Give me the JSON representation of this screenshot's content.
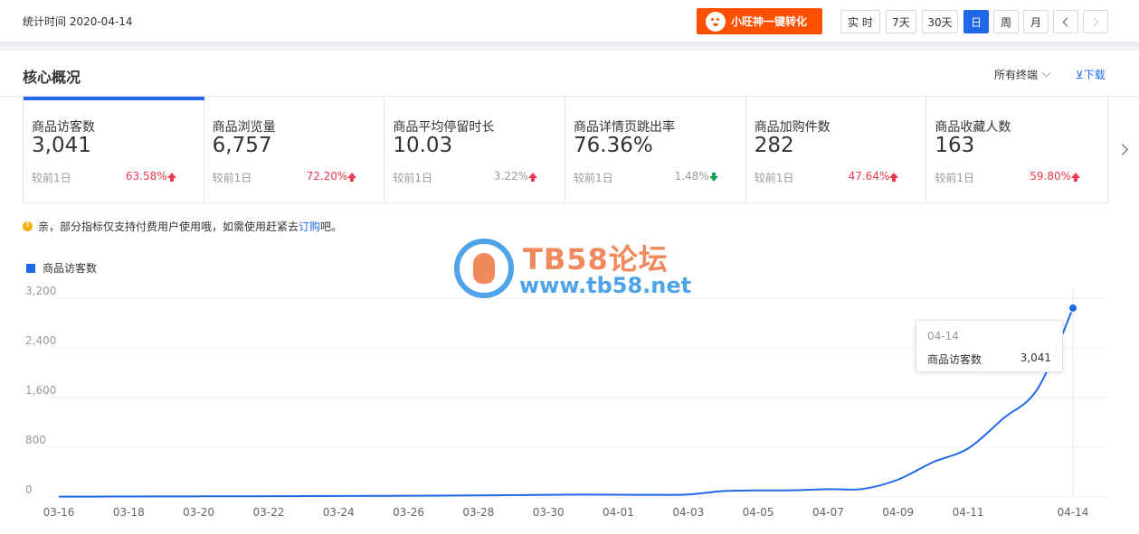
{
  "header": {
    "stat_time": "统计时间 2020-04-14",
    "promo_label": "小旺神一键转化",
    "periods": [
      {
        "label": "实 时",
        "active": false
      },
      {
        "label": "7天",
        "active": false
      },
      {
        "label": "30天",
        "active": false
      },
      {
        "label": "日",
        "active": true
      },
      {
        "label": "周",
        "active": false
      },
      {
        "label": "月",
        "active": false
      }
    ],
    "prev_icon": "chevron-left-icon",
    "next_icon": "chevron-right-icon"
  },
  "panel": {
    "title": "核心概况",
    "terminal_select": "所有终端",
    "download_label": "⊻下载"
  },
  "metrics": [
    {
      "label": "商品访客数",
      "value": "3,041",
      "compare_label": "较前1日",
      "change": "63.58%",
      "direction": "up"
    },
    {
      "label": "商品浏览量",
      "value": "6,757",
      "compare_label": "较前1日",
      "change": "72.20%",
      "direction": "up"
    },
    {
      "label": "商品平均停留时长",
      "value": "10.03",
      "compare_label": "较前1日",
      "change": "3.22%",
      "direction": "up"
    },
    {
      "label": "商品详情页跳出率",
      "value": "76.36%",
      "compare_label": "较前1日",
      "change": "1.48%",
      "direction": "down"
    },
    {
      "label": "商品加购件数",
      "value": "282",
      "compare_label": "较前1日",
      "change": "47.64%",
      "direction": "up"
    },
    {
      "label": "商品收藏人数",
      "value": "163",
      "compare_label": "较前1日",
      "change": "59.80%",
      "direction": "up"
    }
  ],
  "notice": {
    "text": "亲，部分指标仅支持付费用户使用哦，如需使用赶紧去 ",
    "link": "订购",
    "suffix": "吧。"
  },
  "watermark": {
    "title": "TB58论坛",
    "url": "www.tb58.net"
  },
  "tooltip": {
    "date": "04-14",
    "name": "商品访客数",
    "value": "3,041"
  },
  "colors": {
    "accent": "#1f69e8",
    "promo": "#ff5000",
    "up": "#f0394e",
    "down": "#1aa052"
  },
  "chart_data": {
    "type": "line",
    "legend": [
      "商品访客数"
    ],
    "legend_position": "top-left",
    "grid": true,
    "x": [
      "03-16",
      "03-17",
      "03-18",
      "03-19",
      "03-20",
      "03-21",
      "03-22",
      "03-23",
      "03-24",
      "03-25",
      "03-26",
      "03-27",
      "03-28",
      "03-29",
      "03-30",
      "03-31",
      "04-01",
      "04-02",
      "04-03",
      "04-04",
      "04-05",
      "04-06",
      "04-07",
      "04-08",
      "04-09",
      "04-10",
      "04-11",
      "04-12",
      "04-13",
      "04-14"
    ],
    "x_tick_labels": [
      "03-16",
      "03-18",
      "03-20",
      "03-22",
      "03-24",
      "03-26",
      "03-28",
      "03-30",
      "04-01",
      "04-03",
      "04-05",
      "04-07",
      "04-09",
      "04-11",
      "04-14"
    ],
    "y_ticks": [
      0,
      800,
      1600,
      2400,
      3200
    ],
    "ylim": [
      0,
      3200
    ],
    "series": [
      {
        "name": "商品访客数",
        "values": [
          5,
          6,
          8,
          9,
          10,
          11,
          12,
          14,
          16,
          18,
          20,
          22,
          25,
          30,
          35,
          38,
          36,
          34,
          40,
          95,
          105,
          108,
          125,
          130,
          280,
          560,
          780,
          1260,
          1750,
          3041
        ]
      }
    ]
  }
}
